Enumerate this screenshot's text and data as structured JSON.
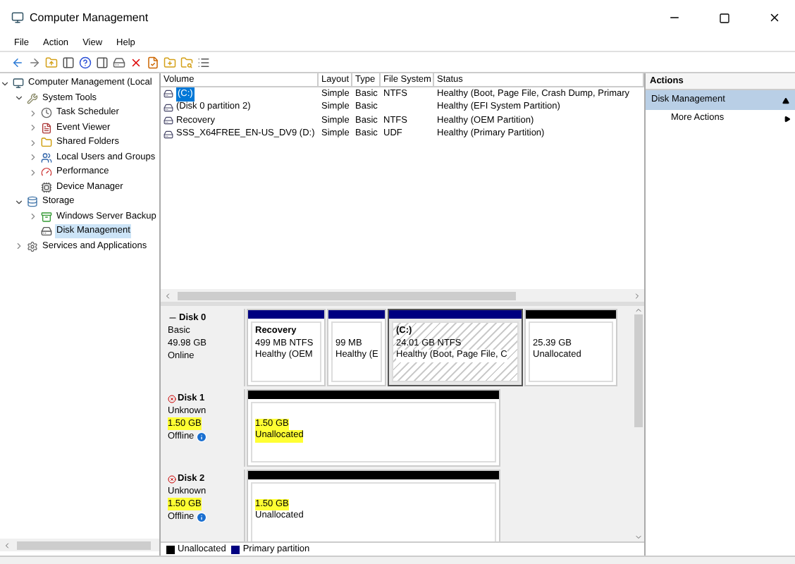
{
  "window": {
    "title": "Computer Management"
  },
  "menu": [
    "File",
    "Action",
    "View",
    "Help"
  ],
  "tree": [
    {
      "label": "Computer Management (Local",
      "expanded": true,
      "selected": false,
      "children": [
        {
          "label": "System Tools",
          "expanded": true,
          "selected": false,
          "children": [
            {
              "label": "Task Scheduler",
              "expanded": false,
              "selected": false
            },
            {
              "label": "Event Viewer",
              "expanded": false,
              "selected": false
            },
            {
              "label": "Shared Folders",
              "expanded": false,
              "selected": false
            },
            {
              "label": "Local Users and Groups",
              "expanded": false,
              "selected": false
            },
            {
              "label": "Performance",
              "expanded": false,
              "selected": false
            },
            {
              "label": "Device Manager",
              "selected": false
            }
          ]
        },
        {
          "label": "Storage",
          "expanded": true,
          "selected": false,
          "children": [
            {
              "label": "Windows Server Backup",
              "expanded": false,
              "selected": false
            },
            {
              "label": "Disk Management",
              "selected": true
            }
          ]
        },
        {
          "label": "Services and Applications",
          "expanded": false,
          "selected": false
        }
      ]
    }
  ],
  "volumes": {
    "columns": [
      "Volume",
      "Layout",
      "Type",
      "File System",
      "Status"
    ],
    "rows": [
      {
        "cells": [
          "(C:)",
          "Simple",
          "Basic",
          "NTFS",
          "Healthy (Boot, Page File, Crash Dump, Primary"
        ],
        "selected": true
      },
      {
        "cells": [
          "(Disk 0 partition 2)",
          "Simple",
          "Basic",
          "",
          "Healthy (EFI System Partition)"
        ],
        "selected": false
      },
      {
        "cells": [
          "Recovery",
          "Simple",
          "Basic",
          "NTFS",
          "Healthy (OEM Partition)"
        ],
        "selected": false
      },
      {
        "cells": [
          "SSS_X64FREE_EN-US_DV9 (D:)",
          "Simple",
          "Basic",
          "UDF",
          "Healthy (Primary Partition)"
        ],
        "selected": false
      }
    ]
  },
  "disks": [
    {
      "name": "Disk 0",
      "offline": false,
      "type": "Basic",
      "size": "49.98 GB",
      "size_highlighted": false,
      "status": "Online",
      "partitions": [
        {
          "kind": "primary",
          "name": "Recovery",
          "size": "499 MB NTFS",
          "status": "Healthy (OEM",
          "selected": false,
          "highlighted": false,
          "status_highlighted": false
        },
        {
          "kind": "primary",
          "size": "99 MB",
          "status": "Healthy (E",
          "selected": false,
          "highlighted": false,
          "status_highlighted": false
        },
        {
          "kind": "primary",
          "name": "(C:)",
          "size": "24.01 GB NTFS",
          "status": "Healthy (Boot, Page File, C",
          "selected": true,
          "highlighted": false,
          "status_highlighted": false
        },
        {
          "kind": "unallocated",
          "size": "25.39 GB",
          "status": "Unallocated",
          "selected": false,
          "highlighted": false,
          "status_highlighted": false
        }
      ]
    },
    {
      "name": "Disk 1",
      "offline": true,
      "type": "Unknown",
      "size": "1.50 GB",
      "size_highlighted": true,
      "status": "Offline",
      "partitions": [
        {
          "kind": "unallocated",
          "size": "1.50 GB",
          "status": "Unallocated",
          "selected": false,
          "highlighted": true,
          "status_highlighted": true
        }
      ]
    },
    {
      "name": "Disk 2",
      "offline": true,
      "type": "Unknown",
      "size": "1.50 GB",
      "size_highlighted": true,
      "status": "Offline",
      "partitions": [
        {
          "kind": "unallocated",
          "size": "1.50 GB",
          "status": "Unallocated",
          "selected": false,
          "highlighted": true,
          "status_highlighted": false
        }
      ]
    }
  ],
  "legend": [
    {
      "label": "Unallocated",
      "color": "#000000"
    },
    {
      "label": "Primary partition",
      "color": "#000080"
    }
  ],
  "actions": {
    "title": "Actions",
    "section": "Disk Management",
    "items": [
      "More Actions"
    ]
  }
}
